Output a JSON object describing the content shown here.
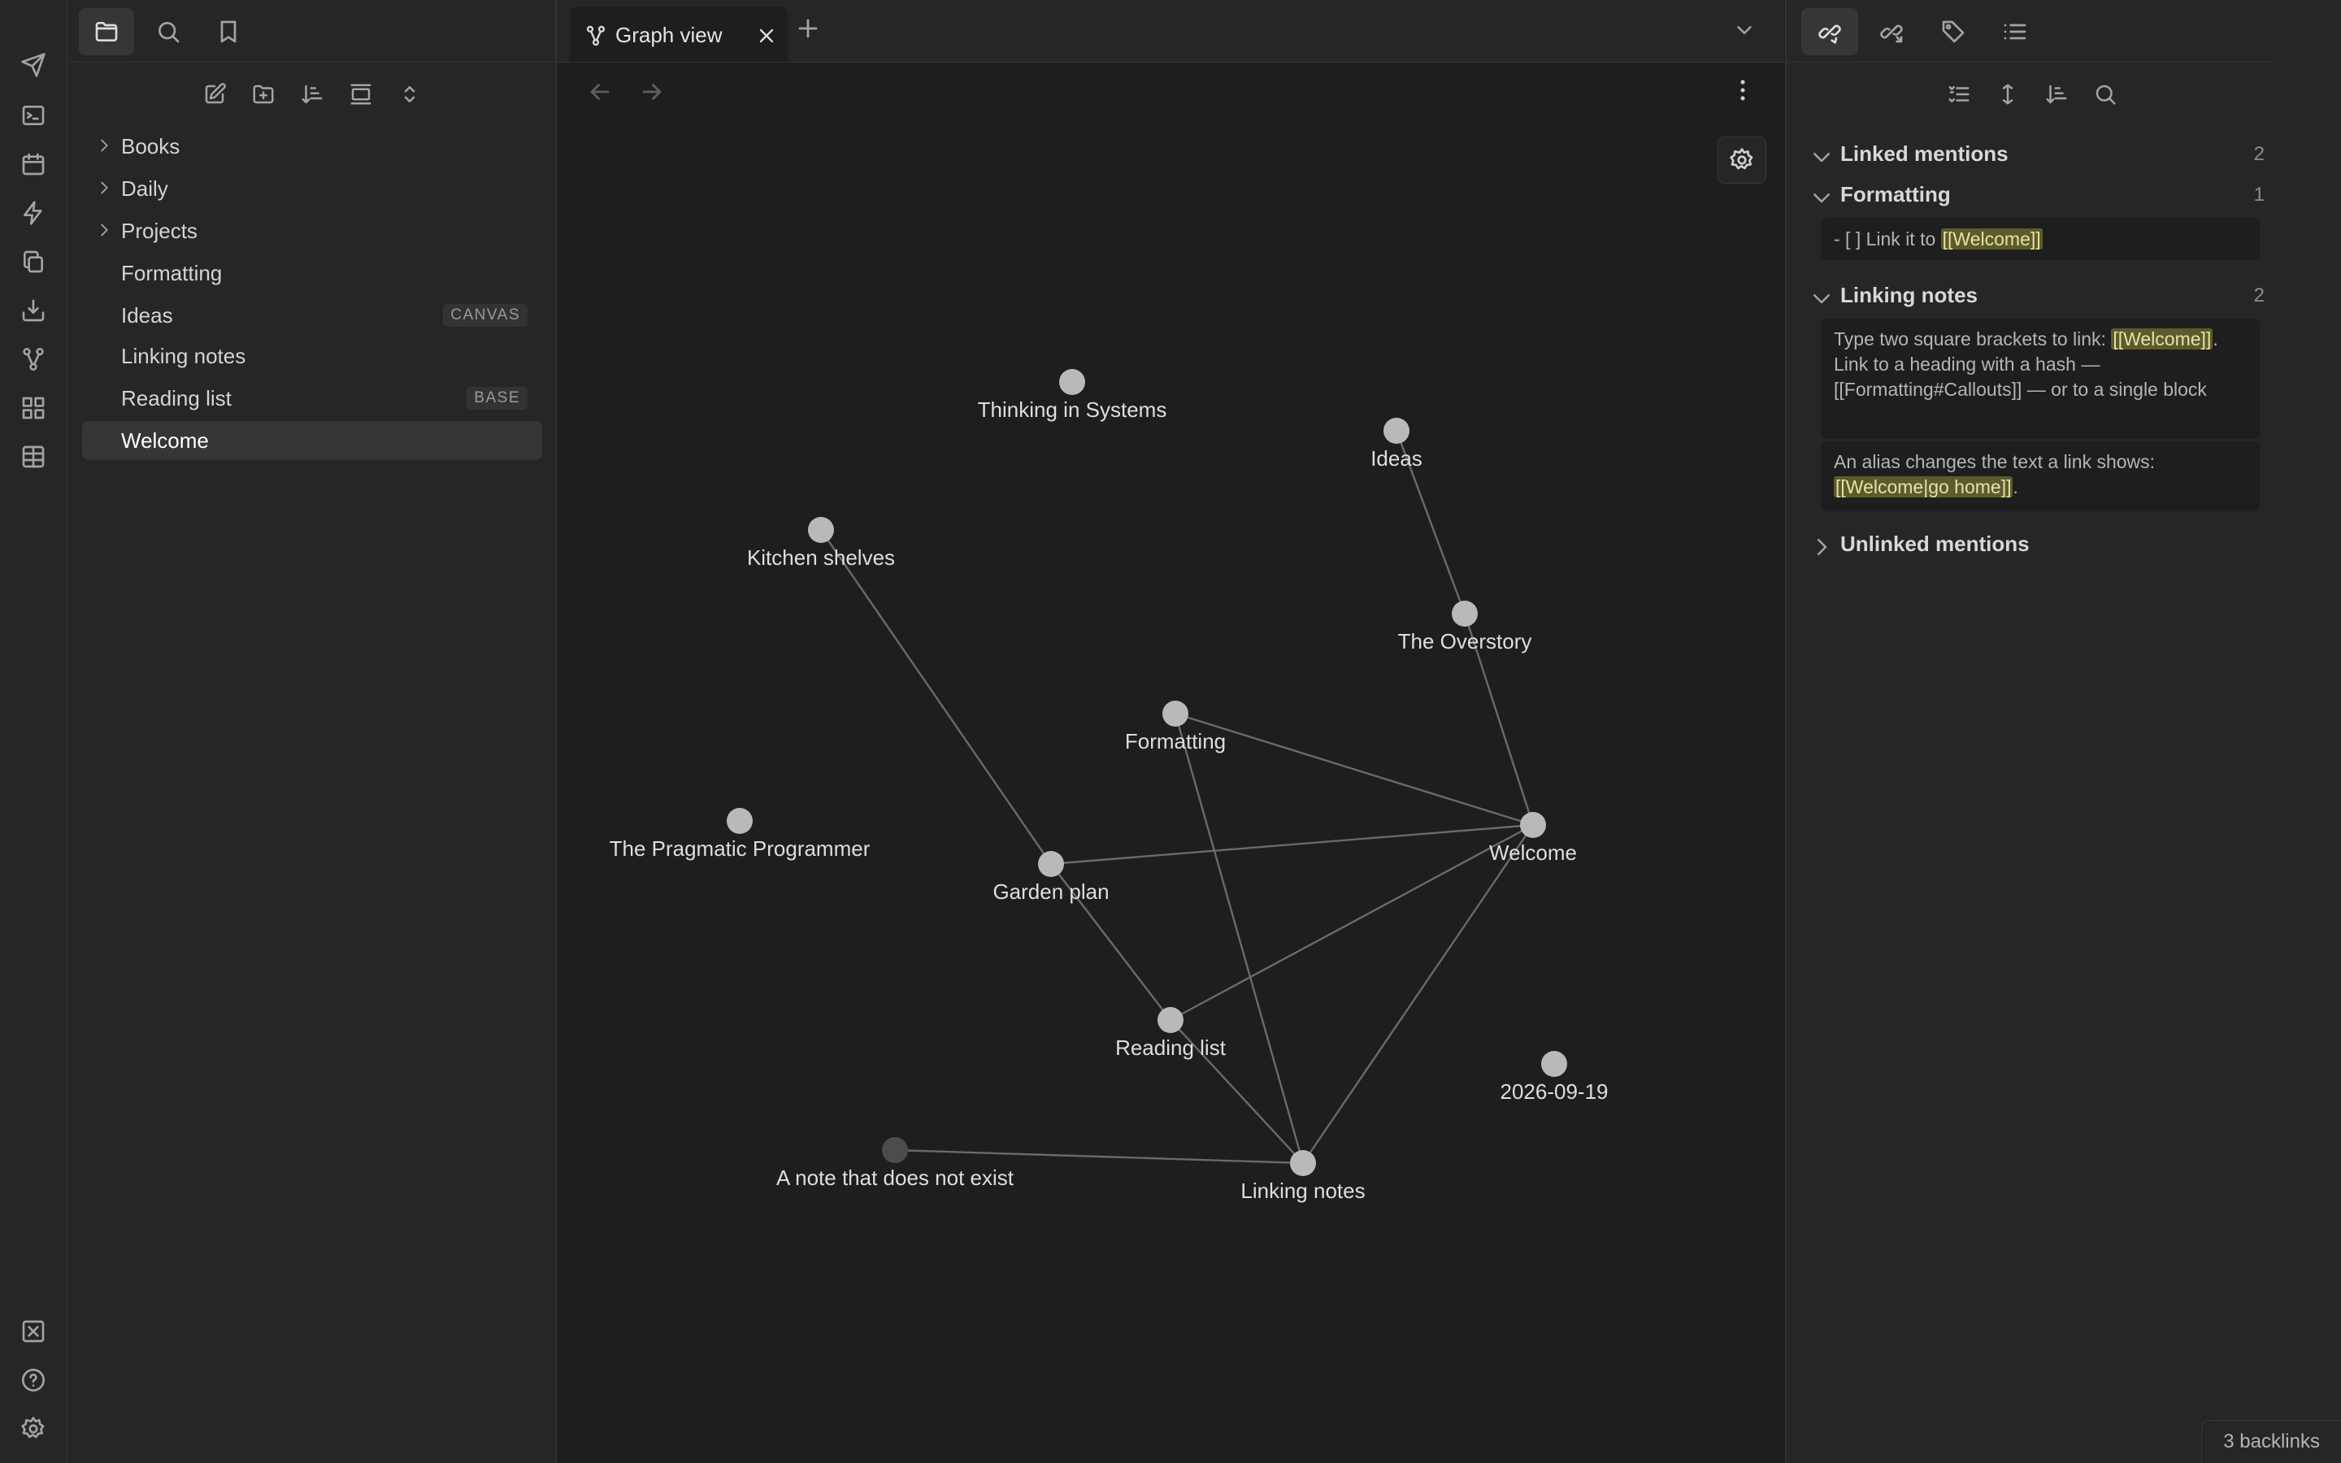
{
  "left_sidebar": {
    "tabs": [
      {
        "icon": "folder-icon",
        "active": true
      },
      {
        "icon": "search-icon"
      },
      {
        "icon": "bookmark-icon"
      }
    ],
    "toolbar": [
      "new-note-icon",
      "new-folder-icon",
      "sort-icon",
      "auto-reveal-icon",
      "expand-collapse-icon"
    ],
    "files": [
      {
        "label": "Books",
        "type": "folder"
      },
      {
        "label": "Daily",
        "type": "folder"
      },
      {
        "label": "Projects",
        "type": "folder"
      },
      {
        "label": "Formatting",
        "type": "file"
      },
      {
        "label": "Ideas",
        "type": "file",
        "badge": "CANVAS"
      },
      {
        "label": "Linking notes",
        "type": "file"
      },
      {
        "label": "Reading list",
        "type": "file",
        "badge": "BASE"
      },
      {
        "label": "Welcome",
        "type": "file",
        "active": true
      }
    ]
  },
  "ribbon": {
    "top": [
      "send-icon",
      "terminal-icon",
      "calendar-icon",
      "lightning-icon",
      "copy-icon",
      "import-icon",
      "graph-icon",
      "grid-icon",
      "table-icon"
    ],
    "bottom": [
      "vault-icon",
      "help-icon",
      "settings-icon"
    ]
  },
  "main": {
    "tab": {
      "title": "Graph view",
      "icon": "graph-icon"
    },
    "graph": {
      "nodes": [
        {
          "id": "thinking",
          "label": "Thinking in Systems"
        },
        {
          "id": "ideas",
          "label": "Ideas"
        },
        {
          "id": "kitchen",
          "label": "Kitchen shelves"
        },
        {
          "id": "overstory",
          "label": "The Overstory"
        },
        {
          "id": "formatting",
          "label": "Formatting"
        },
        {
          "id": "pragmatic",
          "label": "The Pragmatic Programmer"
        },
        {
          "id": "garden",
          "label": "Garden plan"
        },
        {
          "id": "welcome",
          "label": "Welcome"
        },
        {
          "id": "reading",
          "label": "Reading list"
        },
        {
          "id": "date",
          "label": "2026-09-19"
        },
        {
          "id": "missing",
          "label": "A note that does not exist",
          "unresolved": true
        },
        {
          "id": "linking",
          "label": "Linking notes"
        }
      ],
      "links": [
        [
          "ideas",
          "overstory"
        ],
        [
          "overstory",
          "welcome"
        ],
        [
          "kitchen",
          "garden"
        ],
        [
          "formatting",
          "welcome"
        ],
        [
          "formatting",
          "linking"
        ],
        [
          "garden",
          "welcome"
        ],
        [
          "garden",
          "reading"
        ],
        [
          "reading",
          "welcome"
        ],
        [
          "reading",
          "linking"
        ],
        [
          "welcome",
          "linking"
        ],
        [
          "missing",
          "linking"
        ]
      ],
      "colors": {
        "node": "#b9b9b9",
        "unresolved_node": "#4c4c4c",
        "link": "#6a6a6a"
      }
    }
  },
  "right_sidebar": {
    "tabs": [
      "backlinks-icon",
      "outgoing-links-icon",
      "tags-icon",
      "outline-icon"
    ],
    "toolbar": [
      "collapse-results-icon",
      "show-more-context-icon",
      "sort-icon",
      "search-icon"
    ],
    "linked_mentions": {
      "title": "Linked mentions",
      "count": "2",
      "groups": {
        "formatting": {
          "title": "Formatting",
          "count": "1",
          "snippet": {
            "before": "- [ ] Link it to ",
            "link": "[[Welcome]]"
          }
        },
        "linking_notes": {
          "title": "Linking notes",
          "count": "2",
          "snippet1": {
            "before": "Type two square brackets to link: ",
            "link": "[[Welcome]]",
            "after": ". Link to a heading with a hash — [[Formatting#Callouts]] — or to a single block"
          },
          "snippet2": {
            "before": "An alias changes the text a link shows: ",
            "link": "[[Welcome|go home]]",
            "after": "."
          }
        }
      }
    },
    "unlinked_mentions": {
      "title": "Unlinked mentions"
    }
  },
  "status_bar": {
    "backlinks": "3 backlinks"
  },
  "colors": {
    "background": "#1e1e1e",
    "sidebar": "#262626",
    "highlight": "#5d5b2c"
  }
}
